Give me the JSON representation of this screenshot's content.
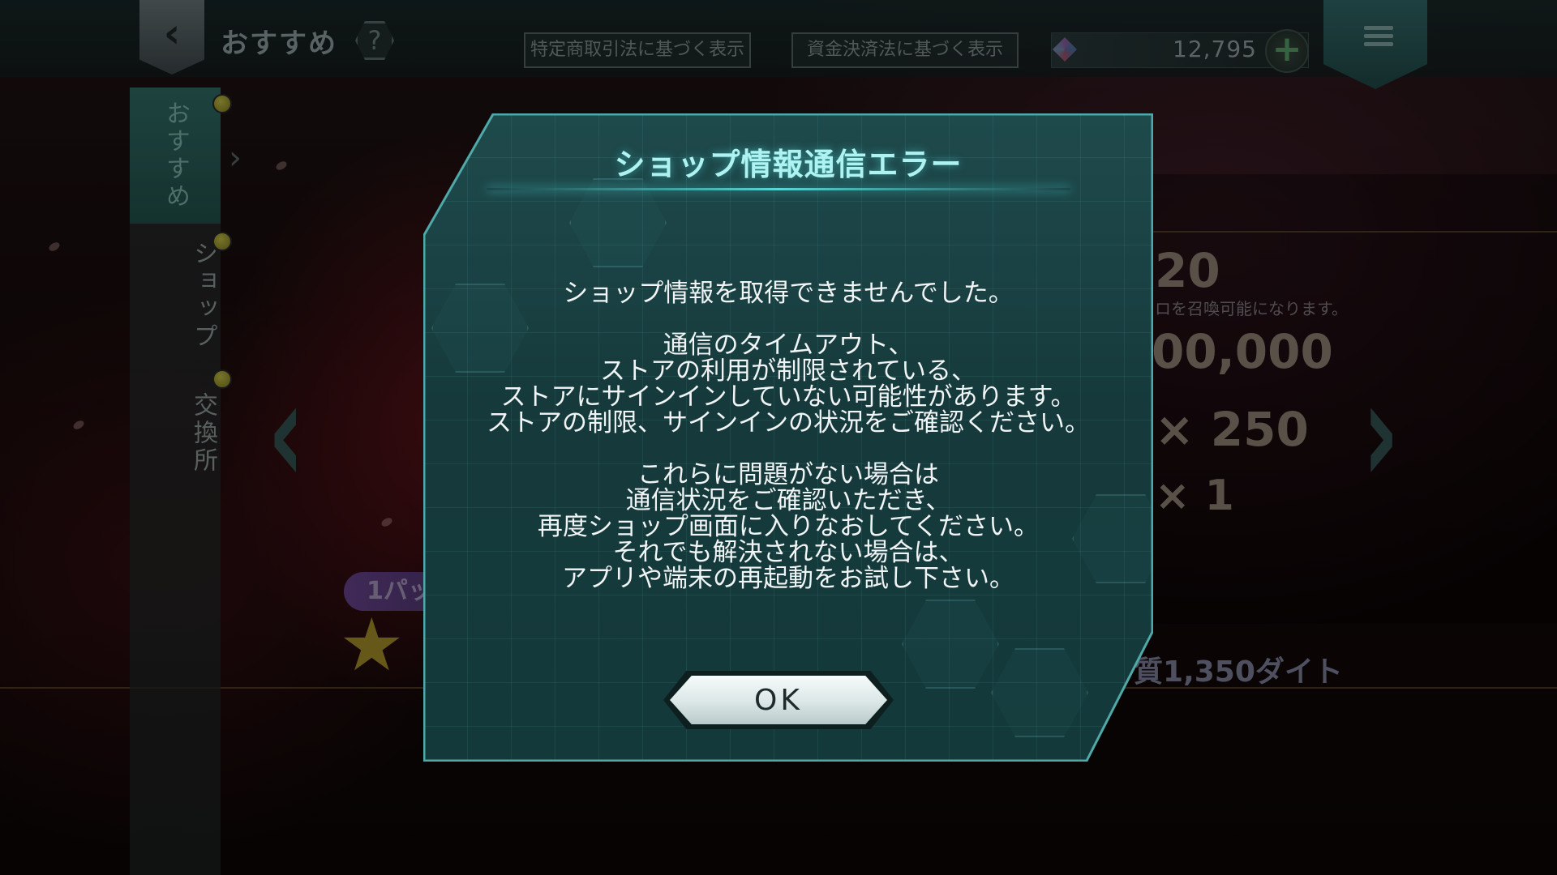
{
  "header": {
    "back_symbol": "‹",
    "title": "おすすめ",
    "help_symbol": "?",
    "legal_buttons": [
      "特定商取引法に基づく表示",
      "資金決済法に基づく表示"
    ],
    "currency": {
      "icon": "gem-icon",
      "value": "12,795",
      "add_symbol": "+"
    }
  },
  "sidebar": {
    "tabs": [
      {
        "label": "おすすめ",
        "active": true
      },
      {
        "label": "ショップ",
        "active": false
      },
      {
        "label": "交換所",
        "active": false
      }
    ]
  },
  "background": {
    "partial_numbers": [
      "20",
      "00,000",
      "× 250",
      "× 1"
    ],
    "partial_sub": "ロを召喚可能になります。",
    "pack_label": "1パッ",
    "price_text": "1,350ダイト",
    "price_prefix": "質"
  },
  "dialog": {
    "title": "ショップ情報通信エラー",
    "message": {
      "p1": "ショップ情報を取得できませんでした。",
      "p2": [
        "通信のタイムアウト、",
        "ストアの利用が制限されている、",
        "ストアにサインインしていない可能性があります。",
        "ストアの制限、サインインの状況をご確認ください。"
      ],
      "p3": [
        "これらに問題がない場合は",
        "通信状況をご確認いただき、",
        "再度ショップ画面に入りなおしてください。",
        "それでも解決されない場合は、",
        "アプリや端末の再起動をお試し下さい。"
      ]
    },
    "ok_label": "OK"
  },
  "colors": {
    "dialog_bg": "#1f4a4c",
    "title_color": "#aef3f2",
    "accent_teal": "#59d6d6",
    "active_tab": "#2a5e58"
  }
}
